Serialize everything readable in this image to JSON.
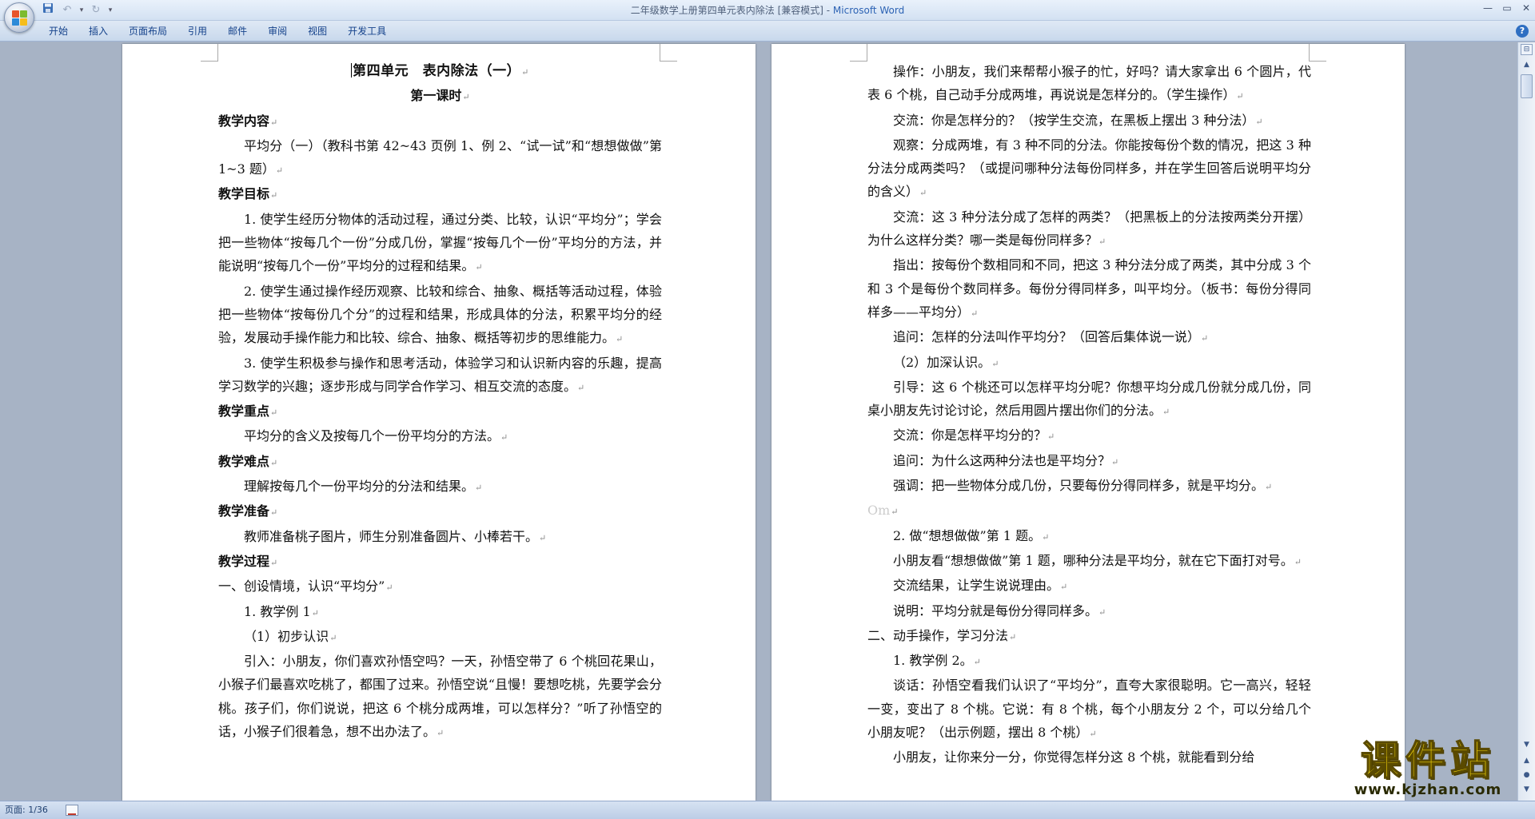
{
  "titlebar": {
    "doc_name": "二年级数学上册第四单元表内除法 [兼容模式] - ",
    "app_name": "Microsoft Word",
    "qat_more": "▾",
    "minimize": "—",
    "restore": "▭",
    "close": "✕"
  },
  "ribbon": {
    "tabs": [
      "开始",
      "插入",
      "页面布局",
      "引用",
      "邮件",
      "审阅",
      "视图",
      "开发工具"
    ],
    "help": "?"
  },
  "pilcrow": "↵",
  "left_page": [
    {
      "text": "第四单元　表内除法（一）",
      "style": "center bold h1",
      "cursor": true
    },
    {
      "text": "第一课时",
      "style": "center bold"
    },
    {
      "text": "教学内容",
      "style": "bold"
    },
    {
      "text": "平均分（一）（教科书第 42~43 页例 1、例 2、“试一试”和“想想做做”第 1~3 题）",
      "style": "indent"
    },
    {
      "text": "教学目标",
      "style": "bold"
    },
    {
      "text": "1. 使学生经历分物体的活动过程，通过分类、比较，认识“平均分”；学会把一些物体“按每几个一份”分成几份，掌握“按每几个一份”平均分的方法，并能说明“按每几个一份”平均分的过程和结果。",
      "style": "indent"
    },
    {
      "text": "2. 使学生通过操作经历观察、比较和综合、抽象、概括等活动过程，体验把一些物体“按每份几个分”的过程和结果，形成具体的分法，积累平均分的经验，发展动手操作能力和比较、综合、抽象、概括等初步的思维能力。",
      "style": "indent"
    },
    {
      "text": "3. 使学生积极参与操作和思考活动，体验学习和认识新内容的乐趣，提高学习数学的兴趣；逐步形成与同学合作学习、相互交流的态度。",
      "style": "indent"
    },
    {
      "text": "教学重点",
      "style": "bold"
    },
    {
      "text": "平均分的含义及按每几个一份平均分的方法。",
      "style": "indent"
    },
    {
      "text": "教学难点",
      "style": "bold"
    },
    {
      "text": "理解按每几个一份平均分的分法和结果。",
      "style": "indent"
    },
    {
      "text": "教学准备",
      "style": "bold"
    },
    {
      "text": "教师准备桃子图片，师生分别准备圆片、小棒若干。",
      "style": "indent"
    },
    {
      "text": "教学过程",
      "style": "bold"
    },
    {
      "text": "一、创设情境，认识“平均分”",
      "style": ""
    },
    {
      "text": "1. 教学例 1",
      "style": "indent"
    },
    {
      "text": "（1）初步认识",
      "style": "indent"
    },
    {
      "text": "引入：小朋友，你们喜欢孙悟空吗？一天，孙悟空带了 6 个桃回花果山，小猴子们最喜欢吃桃了，都围了过来。孙悟空说“且慢！要想吃桃，先要学会分桃。孩子们，你们说说，把这 6 个桃分成两堆，可以怎样分？”听了孙悟空的话，小猴子们很着急，想不出办法了。",
      "style": "indent"
    }
  ],
  "right_page": [
    {
      "text": "操作：小朋友，我们来帮帮小猴子的忙，好吗？请大家拿出 6 个圆片，代表 6 个桃，自己动手分成两堆，再说说是怎样分的。（学生操作）",
      "style": "indent"
    },
    {
      "text": "交流：你是怎样分的？（按学生交流，在黑板上摆出 3 种分法）",
      "style": "indent"
    },
    {
      "text": "观察：分成两堆，有 3 种不同的分法。你能按每份个数的情况，把这 3 种分法分成两类吗？（或提问哪种分法每份同样多，并在学生回答后说明平均分的含义）",
      "style": "indent"
    },
    {
      "text": "交流：这 3 种分法分成了怎样的两类？（把黑板上的分法按两类分开摆）为什么这样分类？哪一类是每份同样多？",
      "style": "indent"
    },
    {
      "text": "指出：按每份个数相同和不同，把这 3 种分法分成了两类，其中分成 3 个和 3 个是每份个数同样多。每份分得同样多，叫平均分。（板书：每份分得同样多——平均分）",
      "style": "indent"
    },
    {
      "text": "追问：怎样的分法叫作平均分？（回答后集体说一说）",
      "style": "indent"
    },
    {
      "text": "（2）加深认识。",
      "style": "indent"
    },
    {
      "text": "引导：这 6 个桃还可以怎样平均分呢？你想平均分成几份就分成几份，同桌小朋友先讨论讨论，然后用圆片摆出你们的分法。",
      "style": "indent"
    },
    {
      "text": "交流：你是怎样平均分的？",
      "style": "indent"
    },
    {
      "text": "追问：为什么这两种分法也是平均分？",
      "style": "indent"
    },
    {
      "text": "强调：把一些物体分成几份，只要每份分得同样多，就是平均分。",
      "style": "indent"
    },
    {
      "text": "Om",
      "style": "faint"
    },
    {
      "text": "2. 做“想想做做”第 1 题。",
      "style": "indent"
    },
    {
      "text": "小朋友看“想想做做”第 1 题，哪种分法是平均分，就在它下面打对号。",
      "style": "indent"
    },
    {
      "text": "交流结果，让学生说说理由。",
      "style": "indent"
    },
    {
      "text": "说明：平均分就是每份分得同样多。",
      "style": "indent"
    },
    {
      "text": "二、动手操作，学习分法",
      "style": ""
    },
    {
      "text": "1. 教学例 2。",
      "style": "indent"
    },
    {
      "text": "谈话：孙悟空看我们认识了“平均分”，直夸大家很聪明。它一高兴，轻轻一变，变出了 8 个桃。它说：有 8 个桃，每个小朋友分 2 个，可以分给几个小朋友呢？（出示例题，摆出 8 个桃）",
      "style": "indent"
    },
    {
      "text": "小朋友，让你来分一分，你觉得怎样分这 8 个桃，就能看到分给",
      "style": "indent",
      "nomark": true
    }
  ],
  "statusbar": {
    "page_indicator": "页面: 1/36"
  },
  "watermark": {
    "title": "课件站",
    "url": "www.kjzhan.com"
  },
  "colors": {
    "accent": "#15428b",
    "app_title": "#2d63b4",
    "doc_bg": "#a7b3c5",
    "watermark": "#f2d40a"
  }
}
